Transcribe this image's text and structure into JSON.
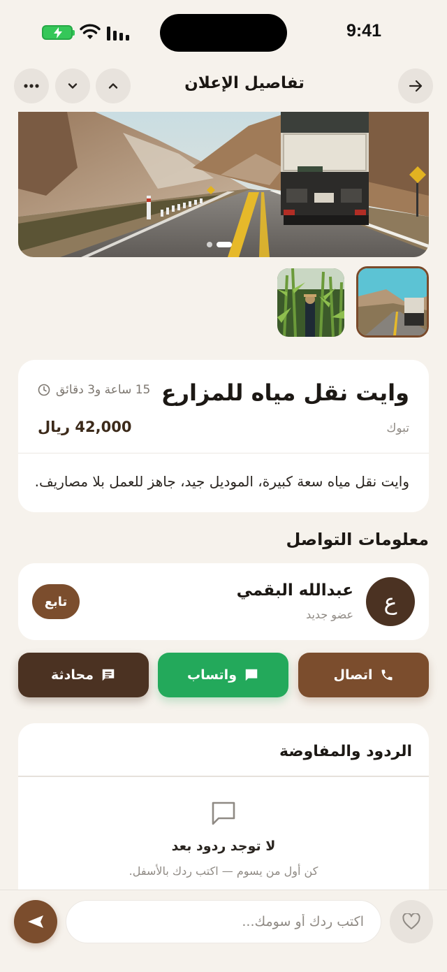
{
  "status_bar": {
    "time": "9:41",
    "icons": [
      "battery-charging-icon",
      "wifi-icon",
      "signal-icon"
    ]
  },
  "header": {
    "title": "تفاصيل الإعلان",
    "icons": [
      "arrow-right-icon",
      "chevron-up-icon",
      "chevron-down-icon",
      "more-dots-icon"
    ]
  },
  "gallery": {
    "slide_count": 2,
    "active_slide": 2,
    "thumbnails": [
      "road-truck-image",
      "cornfield-farmer-image"
    ]
  },
  "listing": {
    "title": "وايت نقل مياه للمزارع",
    "posted_ago": "15 ساعة و3 دقائق",
    "city": "تبوك",
    "price": "42,000 ريال",
    "description": "وايت نقل مياه سعة كبيرة، الموديل جيد، جاهز للعمل بلا مصاريف."
  },
  "contact": {
    "section_title": "معلومات التواصل",
    "seller_initial": "ع",
    "seller_name": "عبدالله البقمي",
    "seller_role": "عضو جديد",
    "follow_label": "تابع",
    "call_label": "اتصال",
    "whatsapp_label": "واتساب",
    "chat_label": "محادثة"
  },
  "replies": {
    "title": "الردود والمفاوضة",
    "empty_title": "لا توجد ردود بعد",
    "empty_subtitle": "كن أول من يسوم — اكتب ردك بالأسفل."
  },
  "composer": {
    "placeholder": "اكتب ردك أو سومك..."
  },
  "colors": {
    "background": "#f6f2ec",
    "brand_brown": "#7b4d2d",
    "dark_brown": "#4b3222",
    "whatsapp_green": "#23a95b"
  }
}
